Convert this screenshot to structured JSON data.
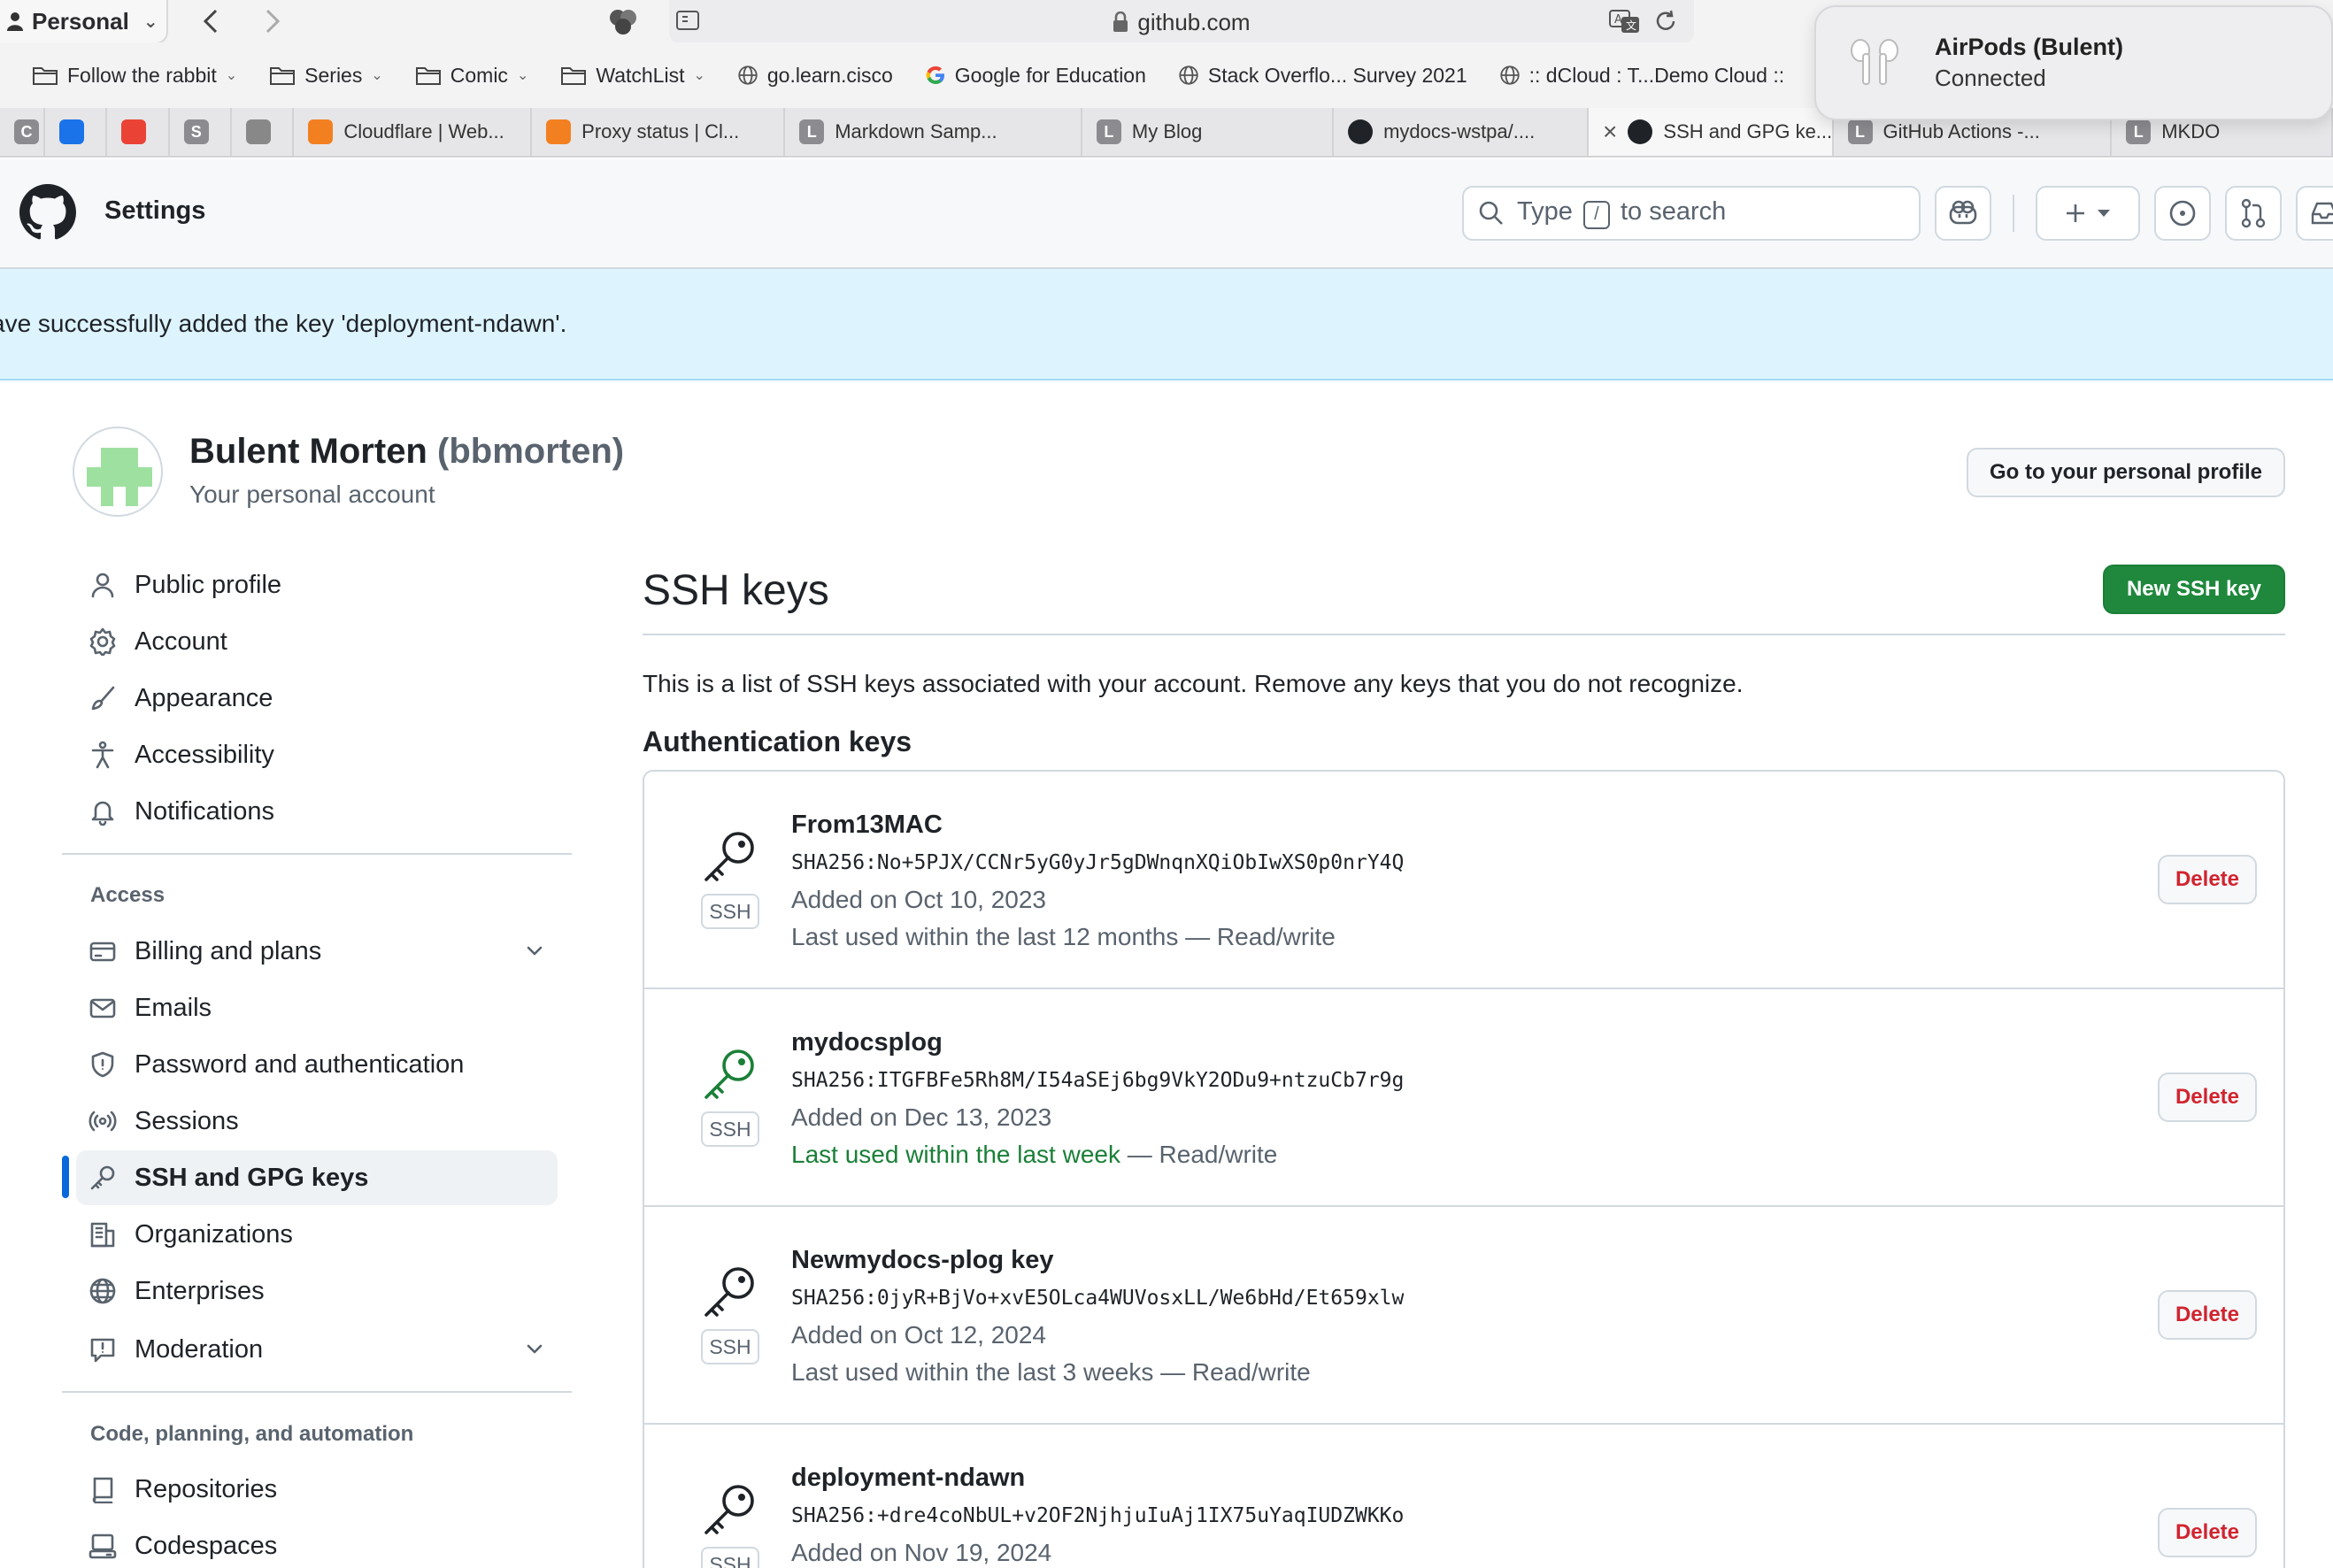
{
  "browser": {
    "profile": "Personal",
    "address": "github.com",
    "bookmarks": [
      {
        "label": "Follow the rabbit",
        "icon": "folder-icon",
        "caret": true
      },
      {
        "label": "Series",
        "icon": "folder-icon",
        "caret": true
      },
      {
        "label": "Comic",
        "icon": "folder-icon",
        "caret": true
      },
      {
        "label": "WatchList",
        "icon": "folder-icon",
        "caret": true
      },
      {
        "label": "go.learn.cisco",
        "icon": "globe-icon",
        "caret": false
      },
      {
        "label": "Google for Education",
        "icon": "google-icon",
        "caret": false
      },
      {
        "label": "Stack Overflo... Survey 2021",
        "icon": "globe-icon",
        "caret": false
      },
      {
        "label": ":: dCloud : T...Demo Cloud ::",
        "icon": "globe-icon",
        "caret": false
      }
    ],
    "tabs": [
      {
        "letter": "C",
        "label": "",
        "color": "#8c8c90"
      },
      {
        "letter": "",
        "label": "",
        "color": "#1a73e8"
      },
      {
        "letter": "",
        "label": "",
        "color": "#ea4335"
      },
      {
        "letter": "S",
        "label": "",
        "color": "#8c8c90"
      },
      {
        "letter": "",
        "label": "",
        "color": "#888888"
      },
      {
        "letter": "",
        "label": "Cloudflare | Web...",
        "color": "#f38020"
      },
      {
        "letter": "",
        "label": "Proxy status | Cl...",
        "color": "#f38020"
      },
      {
        "letter": "L",
        "label": "Markdown Samp...",
        "color": "#8c8c90"
      },
      {
        "letter": "L",
        "label": "My Blog",
        "color": "#8c8c90"
      },
      {
        "letter": "",
        "label": "mydocs-wstpa/....",
        "color": "#1f2328"
      },
      {
        "letter": "",
        "label": "SSH and GPG ke...",
        "color": "#1f2328",
        "active": true
      },
      {
        "letter": "L",
        "label": "GitHub Actions -...",
        "color": "#8c8c90"
      },
      {
        "letter": "L",
        "label": "MKDO",
        "color": "#8c8c90"
      }
    ],
    "notification": {
      "title": "AirPods (Bulent)",
      "subtitle": "Connected"
    }
  },
  "header": {
    "title": "Settings",
    "search": {
      "prefix": "Type",
      "key": "/",
      "suffix": "to search"
    }
  },
  "flash": "ave successfully added the key 'deployment-ndawn'.",
  "account": {
    "name": "Bulent Morten",
    "login": "(bbmorten)",
    "subtitle": "Your personal account",
    "profile_button": "Go to your personal profile"
  },
  "sidebar": {
    "items": [
      {
        "label": "Public profile",
        "icon": "person-icon"
      },
      {
        "label": "Account",
        "icon": "gear-icon"
      },
      {
        "label": "Appearance",
        "icon": "paintbrush-icon"
      },
      {
        "label": "Accessibility",
        "icon": "accessibility-icon"
      },
      {
        "label": "Notifications",
        "icon": "bell-icon"
      }
    ],
    "access_heading": "Access",
    "access_items": [
      {
        "label": "Billing and plans",
        "icon": "credit-card-icon",
        "expandable": true
      },
      {
        "label": "Emails",
        "icon": "mail-icon"
      },
      {
        "label": "Password and authentication",
        "icon": "shield-icon"
      },
      {
        "label": "Sessions",
        "icon": "broadcast-icon"
      },
      {
        "label": "SSH and GPG keys",
        "icon": "key-icon",
        "active": true
      },
      {
        "label": "Organizations",
        "icon": "organization-icon"
      },
      {
        "label": "Enterprises",
        "icon": "globe-icon"
      },
      {
        "label": "Moderation",
        "icon": "report-icon",
        "expandable": true
      }
    ],
    "code_heading": "Code, planning, and automation",
    "code_items": [
      {
        "label": "Repositories",
        "icon": "repo-icon"
      },
      {
        "label": "Codespaces",
        "icon": "codespaces-icon"
      }
    ]
  },
  "main": {
    "title": "SSH keys",
    "new_button": "New SSH key",
    "description": "This is a list of SSH keys associated with your account. Remove any keys that you do not recognize.",
    "auth_heading": "Authentication keys",
    "keys": [
      {
        "name": "From13MAC",
        "fingerprint": "SHA256:No+5PJX/CCNr5yG0yJr5gDWnqnXQiObIwXS0p0nrY4Q",
        "added": "Added on Oct 10, 2023",
        "used": "Last used within the last 12 months",
        "used_recent": false,
        "access": " — Read/write",
        "badge": "SSH",
        "delete": "Delete"
      },
      {
        "name": "mydocsplog",
        "fingerprint": "SHA256:ITGFBFe5Rh8M/I54aSEj6bg9VkY2ODu9+ntzuCb7r9g",
        "added": "Added on Dec 13, 2023",
        "used": "Last used within the last week",
        "used_recent": true,
        "access": " — Read/write",
        "badge": "SSH",
        "delete": "Delete"
      },
      {
        "name": "Newmydocs-plog key",
        "fingerprint": "SHA256:0jyR+BjVo+xvE5OLca4WUVosxLL/We6bHd/Et659xlw",
        "added": "Added on Oct 12, 2024",
        "used": "Last used within the last 3 weeks",
        "used_recent": false,
        "access": " — Read/write",
        "badge": "SSH",
        "delete": "Delete"
      },
      {
        "name": "deployment-ndawn",
        "fingerprint": "SHA256:+dre4coNbUL+v2OF2NjhjuIuAj1IX75uYaqIUDZWKKo",
        "added": "Added on Nov 19, 2024",
        "used": "",
        "used_recent": false,
        "access": "",
        "badge": "SSH",
        "delete": "Delete"
      }
    ]
  },
  "colors": {
    "accent": "#0969da",
    "primary_button": "#1f883d",
    "danger": "#d1242f",
    "recent_used": "#1a7f37",
    "flash_bg": "#ddf4ff"
  }
}
